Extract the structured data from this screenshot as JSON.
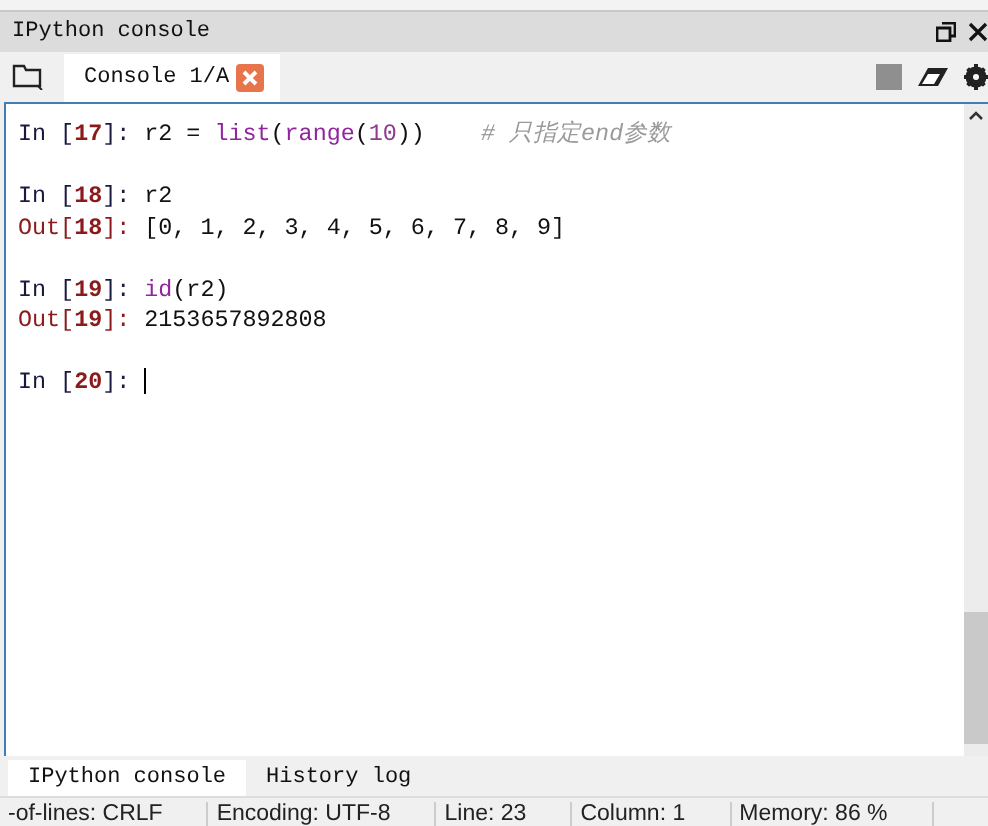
{
  "pane": {
    "title": "IPython console"
  },
  "tabs": [
    {
      "label": "Console 1/A",
      "selected": true
    }
  ],
  "console": {
    "blocks": [
      [
        [
          {
            "kind": "prompt",
            "text": "In ["
          },
          {
            "kind": "prompt-num",
            "text": "17"
          },
          {
            "kind": "prompt",
            "text": "]: "
          },
          {
            "kind": "code",
            "text": "r2 = "
          },
          {
            "kind": "builtin",
            "text": "list"
          },
          {
            "kind": "code",
            "text": "("
          },
          {
            "kind": "builtin",
            "text": "range"
          },
          {
            "kind": "code",
            "text": "("
          },
          {
            "kind": "number",
            "text": "10"
          },
          {
            "kind": "code",
            "text": "))    "
          },
          {
            "kind": "comment",
            "text": "# 只指定end参数"
          }
        ]
      ],
      [
        [
          {
            "kind": "prompt",
            "text": "In ["
          },
          {
            "kind": "prompt-num",
            "text": "18"
          },
          {
            "kind": "prompt",
            "text": "]: "
          },
          {
            "kind": "code",
            "text": "r2"
          }
        ],
        [
          {
            "kind": "out-prompt",
            "text": "Out["
          },
          {
            "kind": "prompt-num",
            "text": "18"
          },
          {
            "kind": "out-prompt",
            "text": "]: "
          },
          {
            "kind": "code",
            "text": "[0, 1, 2, 3, 4, 5, 6, 7, 8, 9]"
          }
        ]
      ],
      [
        [
          {
            "kind": "prompt",
            "text": "In ["
          },
          {
            "kind": "prompt-num",
            "text": "19"
          },
          {
            "kind": "prompt",
            "text": "]: "
          },
          {
            "kind": "builtin",
            "text": "id"
          },
          {
            "kind": "code",
            "text": "(r2)"
          }
        ],
        [
          {
            "kind": "out-prompt",
            "text": "Out["
          },
          {
            "kind": "prompt-num",
            "text": "19"
          },
          {
            "kind": "out-prompt",
            "text": "]: "
          },
          {
            "kind": "code",
            "text": "2153657892808"
          }
        ]
      ],
      [
        [
          {
            "kind": "prompt",
            "text": "In ["
          },
          {
            "kind": "prompt-num",
            "text": "20"
          },
          {
            "kind": "prompt",
            "text": "]: "
          },
          {
            "kind": "cursor"
          }
        ]
      ]
    ]
  },
  "bottom_tabs": [
    {
      "label": "IPython console",
      "selected": true
    },
    {
      "label": "History log",
      "selected": false
    }
  ],
  "status_bar": [
    "-of-lines: CRLF",
    "Encoding: UTF-8",
    "Line: 23",
    "Column: 1",
    "Memory: 86 %"
  ]
}
